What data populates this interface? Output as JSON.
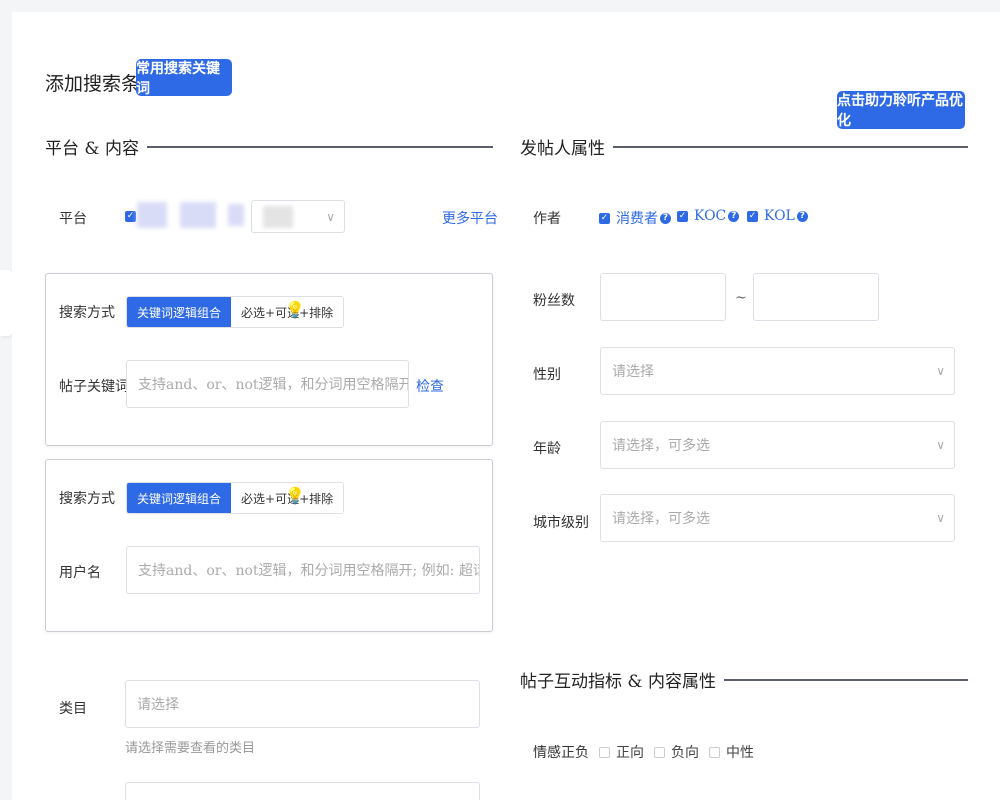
{
  "header": {
    "title": "添加搜索条件",
    "common_keywords_btn": "常用搜索关键词",
    "optimize_btn": "点击助力聆听产品优化"
  },
  "left": {
    "section_title": "平台 & 内容",
    "platform": {
      "label": "平台",
      "more_link": "更多平台"
    },
    "card1": {
      "search_mode_label": "搜索方式",
      "seg_on": "关键词逻辑组合",
      "seg_off": "必选+可选+排除",
      "keyword_label": "帖子关键词",
      "keyword_placeholder": "支持and、or、not逻辑，和分词用空格隔开; 例如: 口红 and",
      "check_link": "检查"
    },
    "card2": {
      "search_mode_label": "搜索方式",
      "seg_on": "关键词逻辑组合",
      "seg_off": "必选+可选+排除",
      "username_label": "用户名",
      "username_placeholder": "支持and、or、not逻辑，和分词用空格隔开; 例如: 超话 and (社区 or 微博) nc"
    },
    "category": {
      "label": "类目",
      "placeholder": "请选择",
      "hint": "请选择需要查看的类目"
    }
  },
  "right": {
    "section_title": "发帖人属性",
    "author": {
      "label": "作者",
      "options": [
        "消费者",
        "KOC",
        "KOL"
      ]
    },
    "fans": {
      "label": "粉丝数",
      "separator": "~"
    },
    "gender": {
      "label": "性别",
      "placeholder": "请选择"
    },
    "age": {
      "label": "年龄",
      "placeholder": "请选择，可多选"
    },
    "city": {
      "label": "城市级别",
      "placeholder": "请选择，可多选"
    },
    "section2_title": "帖子互动指标 & 内容属性",
    "sentiment": {
      "label": "情感正负",
      "options": [
        "正向",
        "负向",
        "中性"
      ]
    }
  },
  "icons": {
    "check": "checkbox-checked-icon",
    "question": "question-icon",
    "bulb": "lightbulb-icon",
    "chevron": "chevron-down-icon"
  },
  "colors": {
    "accent": "#2f6ae6",
    "divider": "#5b5f6b"
  }
}
